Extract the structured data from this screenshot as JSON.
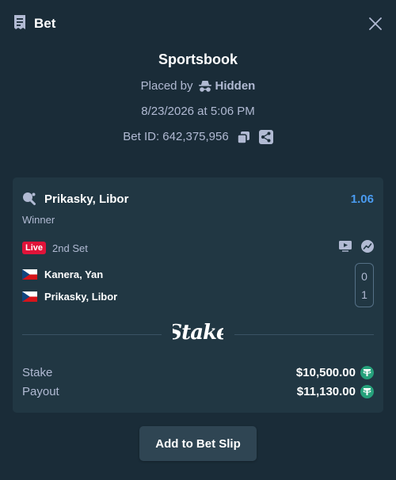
{
  "header": {
    "title": "Bet"
  },
  "info": {
    "sportsbook": "Sportsbook",
    "placed_by_label": "Placed by",
    "placed_by_user": "Hidden",
    "datetime": "8/23/2026 at 5:06 PM",
    "bet_id": "Bet ID: 642,375,956"
  },
  "selection": {
    "name": "Prikasky, Libor",
    "odds": "1.06",
    "market": "Winner",
    "live_label": "Live",
    "set_label": "2nd Set",
    "teams": [
      {
        "name": "Kanera, Yan",
        "score": "0"
      },
      {
        "name": "Prikasky, Libor",
        "score": "1"
      }
    ]
  },
  "logo_text": "Stake",
  "totals": {
    "stake_label": "Stake",
    "stake_amount": "$10,500.00",
    "payout_label": "Payout",
    "payout_amount": "$11,130.00"
  },
  "actions": {
    "add_to_slip": "Add to Bet Slip"
  },
  "colors": {
    "background": "#1a2c38",
    "card": "#213743",
    "odds": "#4a9bf0",
    "live": "#e01339",
    "usdt": "#26a17b"
  }
}
